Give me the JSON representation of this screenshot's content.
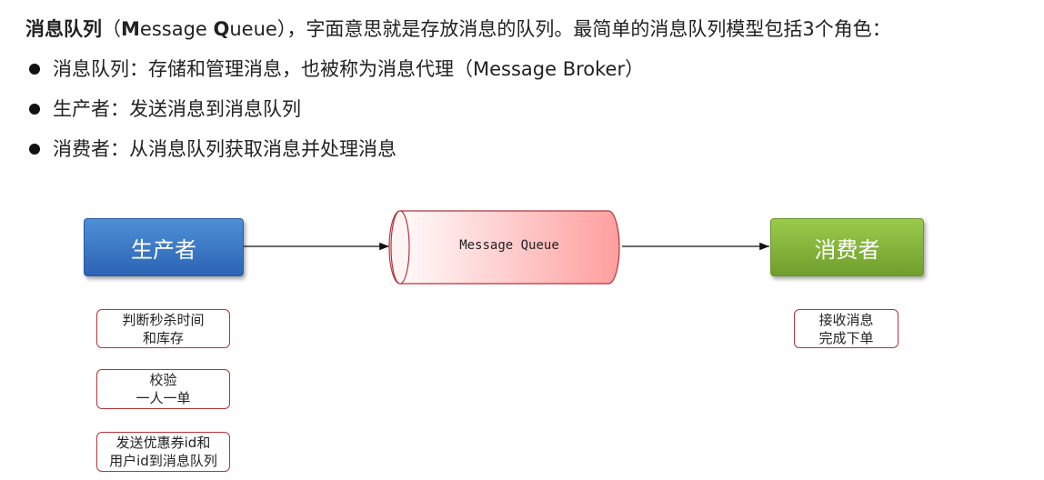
{
  "intro": {
    "term": "消息队列",
    "open_paren": "（",
    "m": "M",
    "essage": "essage ",
    "q": "Q",
    "ueue": "ueue",
    "rest": "），字面意思就是存放消息的队列。最简单的消息队列模型包括3个角色："
  },
  "bullets": [
    {
      "text": "消息队列：存储和管理消息，也被称为消息代理（Message Broker）"
    },
    {
      "text": "生产者：发送消息到消息队列"
    },
    {
      "text": "消费者：从消息队列获取消息并处理消息"
    }
  ],
  "diagram": {
    "producer": "生产者",
    "queue": "Message Queue",
    "consumer": "消费者",
    "producer_notes": [
      {
        "line1": "判断秒杀时间",
        "line2": "和库存"
      },
      {
        "line1": "校验",
        "line2": "一人一单"
      },
      {
        "line1": "发送优惠券id和",
        "line2": "用户id到消息队列"
      }
    ],
    "consumer_note": {
      "line1": "接收消息",
      "line2": "完成下单"
    },
    "colors": {
      "producer": "#2b64b4",
      "consumer": "#6f9e2c",
      "queue_fill": "#ff9e9e",
      "note_border": "#b5343a"
    }
  }
}
